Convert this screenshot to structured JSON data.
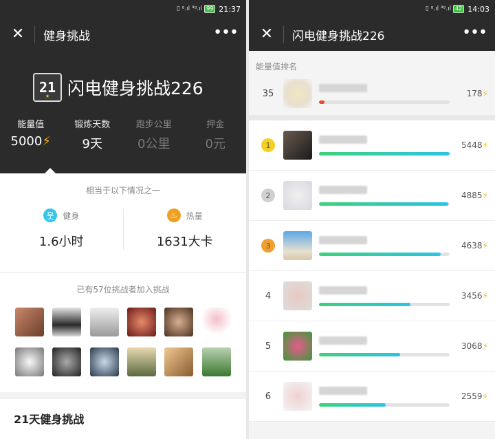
{
  "left": {
    "status": {
      "time": "21:37",
      "battery": "99"
    },
    "nav": {
      "title": "健身挑战"
    },
    "challenge": {
      "logo": "21",
      "name": "闪电健身挑战226"
    },
    "stats": [
      {
        "label": "能量值",
        "value": "5000"
      },
      {
        "label": "锻炼天数",
        "value": "9天"
      },
      {
        "label": "跑步公里",
        "value": "0公里"
      },
      {
        "label": "押金",
        "value": "0元"
      }
    ],
    "equivalent": {
      "caption": "相当于以下情况之一",
      "fitness_label": "健身",
      "fitness_value": "1.6小时",
      "calorie_label": "热量",
      "calorie_value": "1631大卡"
    },
    "joined_caption": "已有57位挑战者加入挑战",
    "section_title": "21天健身挑战"
  },
  "right": {
    "status": {
      "time": "14:03",
      "battery": "42"
    },
    "nav": {
      "title": "闪电健身挑战226"
    },
    "ranking_caption": "能量值排名",
    "self": {
      "rank": "35",
      "value": "178",
      "progress": 0.04
    },
    "rows": [
      {
        "rank": "1",
        "value": "5448",
        "progress": 1.0
      },
      {
        "rank": "2",
        "value": "4885",
        "progress": 0.99
      },
      {
        "rank": "3",
        "value": "4638",
        "progress": 0.93
      },
      {
        "rank": "4",
        "value": "3456",
        "progress": 0.7
      },
      {
        "rank": "5",
        "value": "3068",
        "progress": 0.62
      },
      {
        "rank": "6",
        "value": "2559",
        "progress": 0.51
      }
    ]
  },
  "colors": {
    "navbar": "#2b2b2b",
    "energy": "#f5b800",
    "fitness_icon": "#35c6e8",
    "calorie_icon": "#f0a020",
    "gold": "#f5d020",
    "silver": "#d0d0d0",
    "bronze": "#f0a030"
  }
}
